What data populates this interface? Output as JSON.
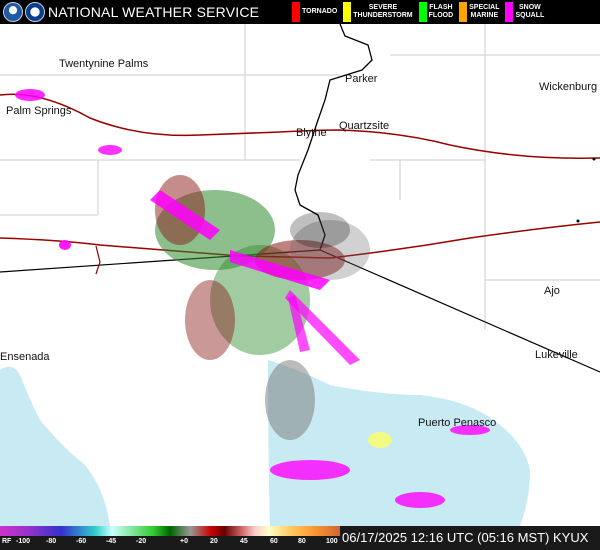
{
  "header": {
    "title": "NATIONAL WEATHER SERVICE",
    "logos": [
      "noaa-logo",
      "nws-logo"
    ],
    "legend": [
      {
        "label": "TORNADO",
        "color": "#ff0000"
      },
      {
        "label": "SEVERE\nTHUNDERSTORM",
        "color": "#ffff00"
      },
      {
        "label": "FLASH\nFLOOD",
        "color": "#00ff00"
      },
      {
        "label": "SPECIAL\nMARINE",
        "color": "#ffa500"
      },
      {
        "label": "SNOW\nSQUALL",
        "color": "#ff00ff"
      }
    ]
  },
  "map": {
    "cities": {
      "twentynine_palms": "Twentynine Palms",
      "parker": "Parker",
      "wickenburg": "Wickenburg",
      "palm_springs": "Palm Springs",
      "blythe": "Blythe",
      "quartzsite": "Quartzsite",
      "ajo": "Ajo",
      "ensenada": "Ensenada",
      "lukeville": "Lukeville",
      "puerto_penasco": "Puerto Penasco"
    },
    "colors": {
      "land": "#ffffff",
      "water": "#c8eaf2",
      "boundary": "#cccccc",
      "state_line": "#000000",
      "interstate": "#990000"
    }
  },
  "scale": {
    "prefix": "RF",
    "ticks": [
      "-100",
      "-80",
      "-60",
      "-45",
      "-20",
      "+0",
      "20",
      "45",
      "60",
      "80",
      "100"
    ]
  },
  "timestamp": "06/17/2025 12:16 UTC (05:16 MST) KYUX"
}
